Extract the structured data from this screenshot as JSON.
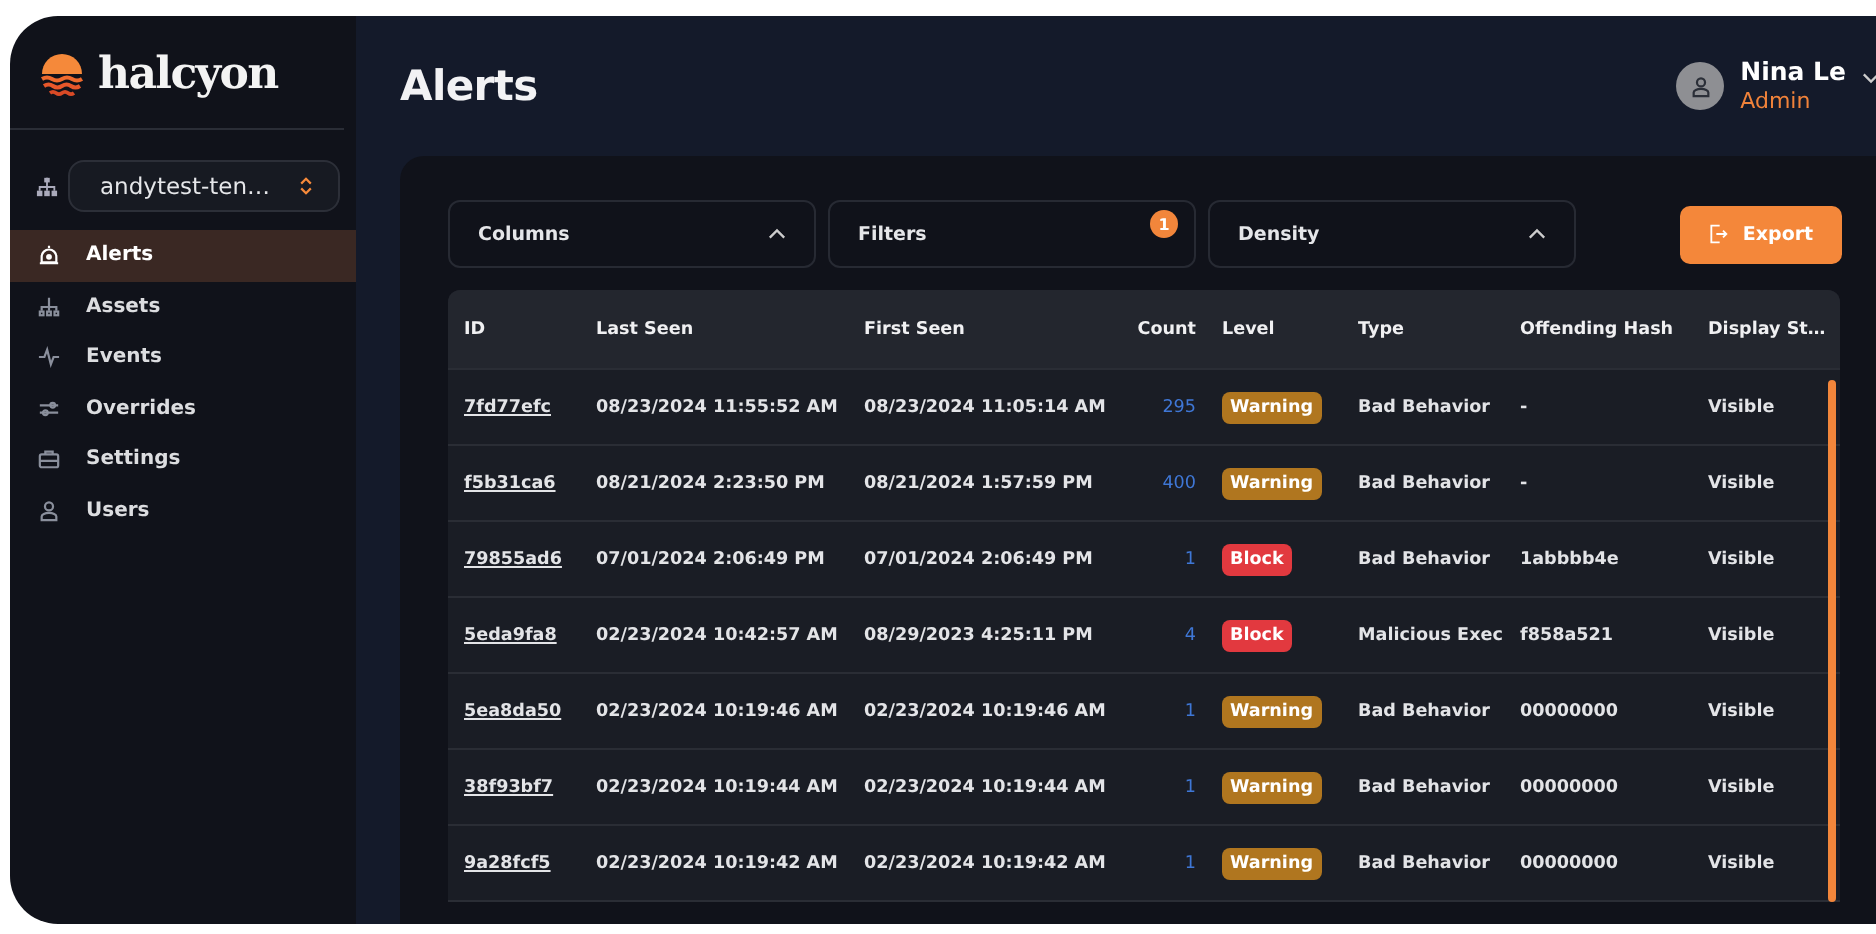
{
  "brand": {
    "name": "halcyon"
  },
  "tenant": {
    "value": "andytest-ten…"
  },
  "nav": [
    {
      "label": "Alerts",
      "kind": "alert",
      "selected": true
    },
    {
      "label": "Assets",
      "kind": "assets",
      "selected": false
    },
    {
      "label": "Events",
      "kind": "pulse",
      "selected": false
    },
    {
      "label": "Overrides",
      "kind": "sliders",
      "selected": false
    },
    {
      "label": "Settings",
      "kind": "case",
      "selected": false
    },
    {
      "label": "Users",
      "kind": "user",
      "selected": false
    }
  ],
  "page": {
    "title": "Alerts"
  },
  "user": {
    "name": "Nina Le",
    "role": "Admin"
  },
  "toolbar": {
    "columns": "Columns",
    "filters": "Filters",
    "filter_count": "1",
    "density": "Density",
    "export": "Export"
  },
  "table": {
    "columns": [
      "ID",
      "Last Seen",
      "First Seen",
      "Count",
      "Level",
      "Type",
      "Offending Hash",
      "Display St…"
    ],
    "rows": [
      {
        "id": "7fd77efc",
        "last_seen": "08/23/2024 11:55:52 AM",
        "first_seen": "08/23/2024 11:05:14 AM",
        "count": "295",
        "level": {
          "kind": "warning",
          "label": "Warning"
        },
        "type": "Bad Behavior",
        "hash": "-",
        "display": "Visible"
      },
      {
        "id": "f5b31ca6",
        "last_seen": "08/21/2024 2:23:50 PM",
        "first_seen": "08/21/2024 1:57:59 PM",
        "count": "400",
        "level": {
          "kind": "warning",
          "label": "Warning"
        },
        "type": "Bad Behavior",
        "hash": "-",
        "display": "Visible"
      },
      {
        "id": "79855ad6",
        "last_seen": "07/01/2024 2:06:49 PM",
        "first_seen": "07/01/2024 2:06:49 PM",
        "count": "1",
        "level": {
          "kind": "block",
          "label": "Block"
        },
        "type": "Bad Behavior",
        "hash": "1abbbb4e",
        "display": "Visible"
      },
      {
        "id": "5eda9fa8",
        "last_seen": "02/23/2024 10:42:57 AM",
        "first_seen": "08/29/2023 4:25:11 PM",
        "count": "4",
        "level": {
          "kind": "block",
          "label": "Block"
        },
        "type": "Malicious Exec",
        "hash": "f858a521",
        "display": "Visible"
      },
      {
        "id": "5ea8da50",
        "last_seen": "02/23/2024 10:19:46 AM",
        "first_seen": "02/23/2024 10:19:46 AM",
        "count": "1",
        "level": {
          "kind": "warning",
          "label": "Warning"
        },
        "type": "Bad Behavior",
        "hash": "00000000",
        "display": "Visible"
      },
      {
        "id": "38f93bf7",
        "last_seen": "02/23/2024 10:19:44 AM",
        "first_seen": "02/23/2024 10:19:44 AM",
        "count": "1",
        "level": {
          "kind": "warning",
          "label": "Warning"
        },
        "type": "Bad Behavior",
        "hash": "00000000",
        "display": "Visible"
      },
      {
        "id": "9a28fcf5",
        "last_seen": "02/23/2024 10:19:42 AM",
        "first_seen": "02/23/2024 10:19:42 AM",
        "count": "1",
        "level": {
          "kind": "warning",
          "label": "Warning"
        },
        "type": "Bad Behavior",
        "hash": "00000000",
        "display": "Visible"
      }
    ]
  }
}
